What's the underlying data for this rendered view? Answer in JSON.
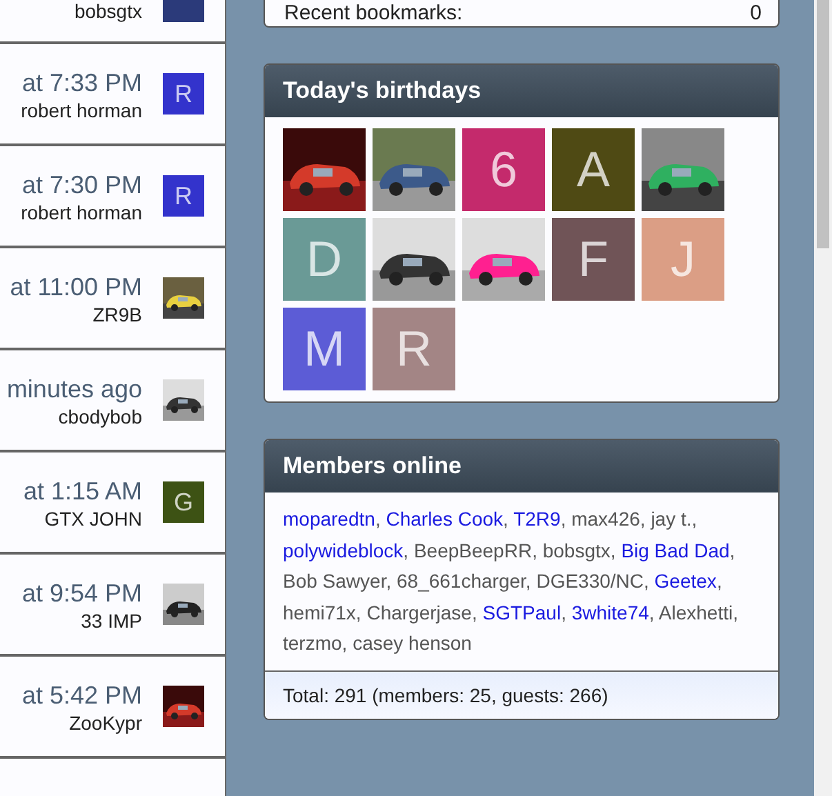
{
  "activity": [
    {
      "user": "bobsgtx",
      "avatar": {
        "kind": "letter",
        "color": "#2b3a7a"
      }
    },
    {
      "time": "at 7:33 PM",
      "user": "robert horman",
      "avatar": {
        "kind": "letter",
        "letter": "R",
        "color": "#3333cc"
      }
    },
    {
      "time": "at 7:30 PM",
      "user": "robert horman",
      "avatar": {
        "kind": "letter",
        "letter": "R",
        "color": "#3333cc"
      }
    },
    {
      "time": "at 11:00 PM",
      "user": "ZR9B",
      "avatar": {
        "kind": "picture"
      }
    },
    {
      "time": "minutes ago",
      "user": "cbodybob",
      "avatar": {
        "kind": "picture"
      }
    },
    {
      "time": "at 1:15 AM",
      "user": "GTX JOHN",
      "avatar": {
        "kind": "letter",
        "letter": "G",
        "color": "#3d5214"
      }
    },
    {
      "time": "at 9:54 PM",
      "user": "33 IMP",
      "avatar": {
        "kind": "picture"
      }
    },
    {
      "time": "at 5:42 PM",
      "user": "ZooKypr",
      "avatar": {
        "kind": "picture"
      }
    }
  ],
  "bookmarks": {
    "label": "Recent bookmarks:",
    "count": "0"
  },
  "birthdays": {
    "title": "Today's birthdays",
    "avatars": [
      {
        "kind": "picture"
      },
      {
        "kind": "picture"
      },
      {
        "kind": "letter",
        "letter": "6",
        "color": "#c42a6c"
      },
      {
        "kind": "letter",
        "letter": "A",
        "color": "#4f4a14"
      },
      {
        "kind": "picture"
      },
      {
        "kind": "letter",
        "letter": "D",
        "color": "#6a9a96"
      },
      {
        "kind": "picture"
      },
      {
        "kind": "picture"
      },
      {
        "kind": "letter",
        "letter": "F",
        "color": "#705457"
      },
      {
        "kind": "letter",
        "letter": "J",
        "color": "#db9e85"
      },
      {
        "kind": "letter",
        "letter": "M",
        "color": "#5c5cd6"
      },
      {
        "kind": "letter",
        "letter": "R",
        "color": "#a38585"
      }
    ]
  },
  "members_online": {
    "title": "Members online",
    "separator": ",",
    "members": [
      {
        "name": "moparedtn",
        "link": true
      },
      {
        "name": "Charles Cook",
        "link": true
      },
      {
        "name": "T2R9",
        "link": true
      },
      {
        "name": "max426",
        "link": false
      },
      {
        "name": "jay t.",
        "link": false
      },
      {
        "name": "polywideblock",
        "link": true
      },
      {
        "name": "BeepBeepRR",
        "link": false
      },
      {
        "name": "bobsgtx",
        "link": false
      },
      {
        "name": "Big Bad Dad",
        "link": true
      },
      {
        "name": "Bob Sawyer",
        "link": false
      },
      {
        "name": "68_661charger",
        "link": false
      },
      {
        "name": "DGE330/NC",
        "link": false
      },
      {
        "name": "Geetex",
        "link": true
      },
      {
        "name": "hemi71x",
        "link": false
      },
      {
        "name": "Chargerjase",
        "link": false
      },
      {
        "name": "SGTPaul",
        "link": true
      },
      {
        "name": "3white74",
        "link": true
      },
      {
        "name": "Alexhetti",
        "link": false
      },
      {
        "name": "terzmo",
        "link": false
      },
      {
        "name": "casey henson",
        "link": false
      }
    ],
    "total": "Total: 291 (members: 25, guests: 266)"
  }
}
